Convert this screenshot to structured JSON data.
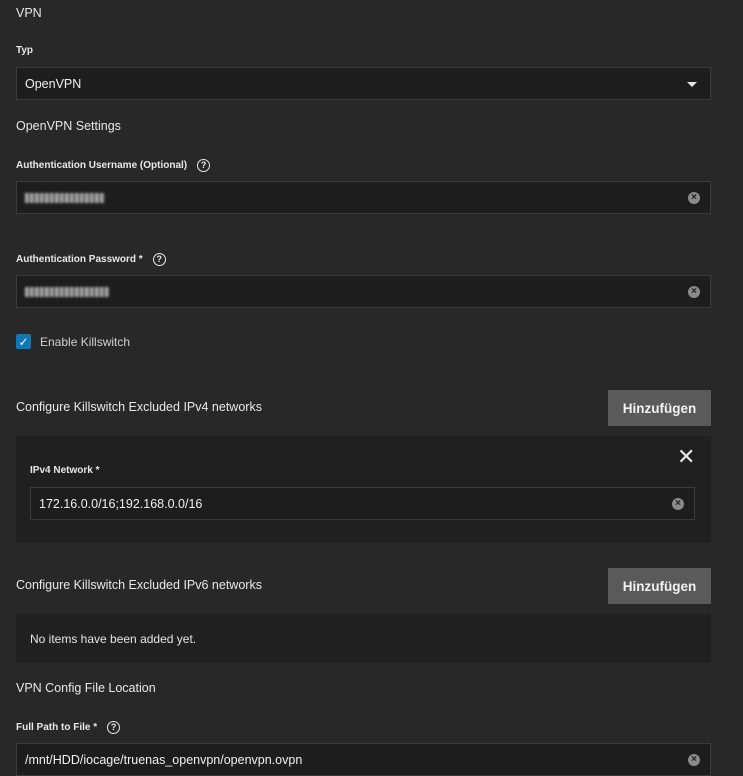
{
  "vpn": {
    "section_title": "VPN",
    "type_label": "Typ",
    "type_value": "OpenVPN"
  },
  "openvpn_settings": {
    "section_title": "OpenVPN Settings",
    "username_label": "Authentication Username (Optional)",
    "username_help_icon": "help-circle-icon",
    "password_label": "Authentication Password *",
    "password_help_icon": "help-circle-icon"
  },
  "killswitch": {
    "enable_label": "Enable Killswitch",
    "enabled": true,
    "ipv4": {
      "title": "Configure Killswitch Excluded IPv4 networks",
      "add_button": "Hinzufügen",
      "network_label": "IPv4 Network *",
      "network_value": "172.16.0.0/16;192.168.0.0/16"
    },
    "ipv6": {
      "title": "Configure Killswitch Excluded IPv6 networks",
      "add_button": "Hinzufügen",
      "empty_message": "No items have been added yet."
    }
  },
  "config_file": {
    "section_title": "VPN Config File Location",
    "path_label": "Full Path to File *",
    "path_value": "/mnt/HDD/iocage/truenas_openvpn/openvpn.ovpn"
  },
  "colors": {
    "background": "#282828",
    "input_background": "#1d1d1d",
    "button_background": "#5a5a5a",
    "checkbox_accent": "#0f78b7"
  }
}
